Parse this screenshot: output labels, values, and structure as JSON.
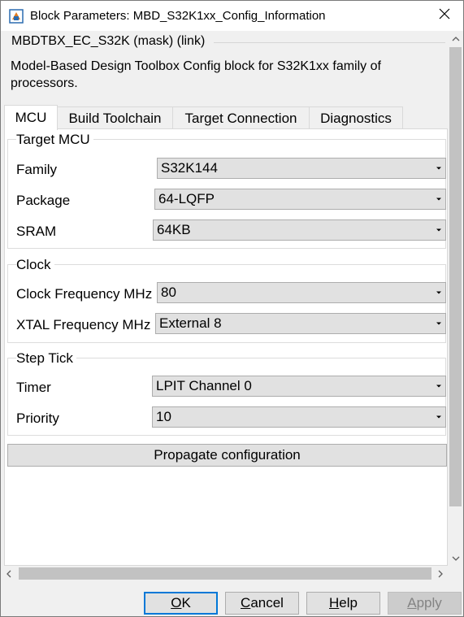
{
  "window": {
    "title": "Block Parameters: MBD_S32K1xx_Config_Information"
  },
  "mask": {
    "title": "MBDTBX_EC_S32K (mask) (link)",
    "description": "Model-Based Design Toolbox Config block for S32K1xx family of processors."
  },
  "tabs": [
    {
      "label": "MCU",
      "active": true
    },
    {
      "label": "Build Toolchain",
      "active": false
    },
    {
      "label": "Target Connection",
      "active": false
    },
    {
      "label": "Diagnostics",
      "active": false
    }
  ],
  "groups": {
    "target_mcu": {
      "title": "Target MCU",
      "rows": [
        {
          "label": "Family",
          "value": "S32K144"
        },
        {
          "label": "Package",
          "value": "64-LQFP"
        },
        {
          "label": "SRAM",
          "value": "64KB"
        }
      ]
    },
    "clock": {
      "title": "Clock",
      "rows": [
        {
          "label": "Clock Frequency MHz",
          "value": "80"
        },
        {
          "label": "XTAL Frequency MHz",
          "value": "External 8"
        }
      ]
    },
    "step_tick": {
      "title": "Step Tick",
      "rows": [
        {
          "label": "Timer",
          "value": "LPIT Channel 0"
        },
        {
          "label": "Priority",
          "value": "10"
        }
      ]
    }
  },
  "propagate_button": "Propagate configuration",
  "buttons": {
    "ok": {
      "mnemonic": "O",
      "rest": "K"
    },
    "cancel": {
      "mnemonic": "C",
      "rest": "ancel"
    },
    "help": {
      "mnemonic": "H",
      "rest": "elp"
    },
    "apply": {
      "mnemonic": "A",
      "rest": "pply"
    }
  },
  "colors": {
    "default_button_border": "#0078d7",
    "window_bg": "#f0f0f0",
    "panel_bg": "#ffffff"
  },
  "icons": {
    "app": "simulink-block-icon",
    "close": "close-icon",
    "dropdown": "chevron-down-icon"
  }
}
